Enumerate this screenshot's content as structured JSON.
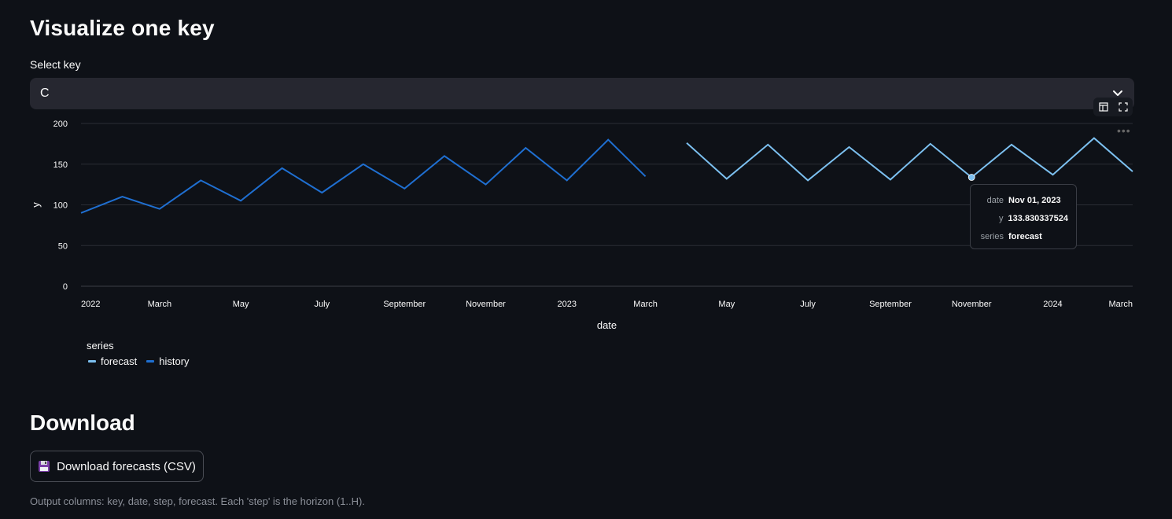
{
  "page": {
    "title": "Visualize one key",
    "select_label": "Select key",
    "select_value": "C"
  },
  "download": {
    "title": "Download",
    "button_label": "Download forecasts (CSV)",
    "caption": "Output columns: key, date, step, forecast. Each 'step' is the horizon (1..H)."
  },
  "colors": {
    "history": "#1f6fd1",
    "forecast": "#7cc0f0",
    "background": "#0e1117"
  },
  "chart_data": {
    "type": "line",
    "xlabel": "date",
    "ylabel": "y",
    "ylim": [
      0,
      200
    ],
    "y_ticks": [
      0,
      50,
      100,
      150,
      200
    ],
    "x_tick_labels": [
      "2022",
      "March",
      "May",
      "July",
      "September",
      "November",
      "2023",
      "March",
      "May",
      "July",
      "September",
      "November",
      "2024",
      "March"
    ],
    "grid": true,
    "legend_title": "series",
    "legend_placement": "bottom-left",
    "series": [
      {
        "name": "history",
        "x": [
          "2022-01-01",
          "2022-02-01",
          "2022-03-01",
          "2022-04-01",
          "2022-05-01",
          "2022-06-01",
          "2022-07-01",
          "2022-08-01",
          "2022-09-01",
          "2022-10-01",
          "2022-11-01",
          "2022-12-01",
          "2023-01-01",
          "2023-02-01",
          "2023-03-01"
        ],
        "values": [
          90,
          110,
          95,
          130,
          105,
          145,
          115,
          150,
          120,
          160,
          125,
          170,
          130,
          180,
          135
        ]
      },
      {
        "name": "forecast",
        "x": [
          "2023-04-01",
          "2023-05-01",
          "2023-06-01",
          "2023-07-01",
          "2023-08-01",
          "2023-09-01",
          "2023-10-01",
          "2023-11-01",
          "2023-12-01",
          "2024-01-01",
          "2024-02-01",
          "2024-03-01"
        ],
        "values": [
          176,
          132,
          174,
          130,
          171,
          131,
          175,
          133.83,
          174,
          137,
          182,
          141
        ]
      }
    ],
    "tooltip": {
      "date_label": "date",
      "date_value": "Nov 01, 2023",
      "y_label": "y",
      "y_value": "133.830337524",
      "series_label": "series",
      "series_value": "forecast"
    }
  }
}
